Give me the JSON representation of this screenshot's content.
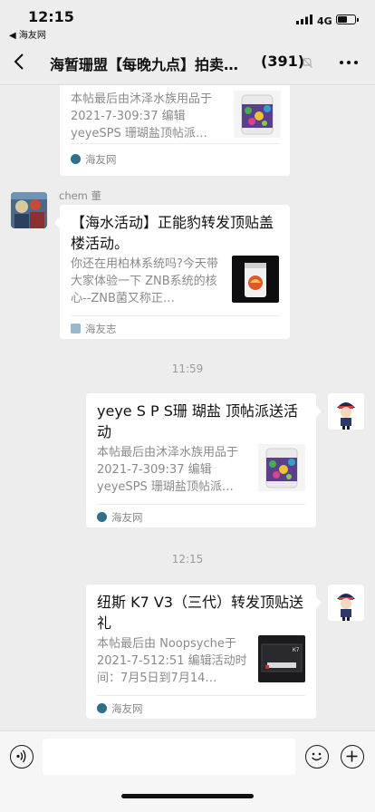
{
  "status": {
    "time": "12:15",
    "back_app": "◀ 海友网",
    "network": "4G"
  },
  "nav": {
    "title": "海暂珊盟【每晚九点】拍卖…",
    "count": "(391)"
  },
  "messages": [
    {
      "desc": "本帖最后由沐泽水族用品于 2021-7-309:37 编辑 yeyeSPS 珊瑚盐顶帖派…",
      "source": "海友网"
    },
    {
      "sender": "chem 董",
      "title": "【海水活动】正能豹转发顶贴盖楼活动。",
      "desc": "你还在用柏林系统吗?今天带大家体验一下 ZNB系统的核心--ZNB菌又称正…",
      "source": "海友志"
    },
    {
      "time": "11:59",
      "title": "yeye S P S珊 瑚盐 顶帖派送活动",
      "desc": "本帖最后由沐泽水族用品于 2021-7-309:37 编辑 yeyeSPS 珊瑚盐顶帖派…",
      "source": "海友网"
    },
    {
      "time": "12:15",
      "title": "纽斯 K7 V3（三代）转发顶贴送礼",
      "desc": "本帖最后由 Noopsyche于 2021-7-512:51 编辑活动时间：7月5日到7月14…",
      "source": "海友网"
    }
  ],
  "thumb_labels": {
    "k7": "K7"
  },
  "colors": {
    "bg": "#ededed",
    "card": "#ffffff",
    "muted": "#8a8a8a"
  }
}
